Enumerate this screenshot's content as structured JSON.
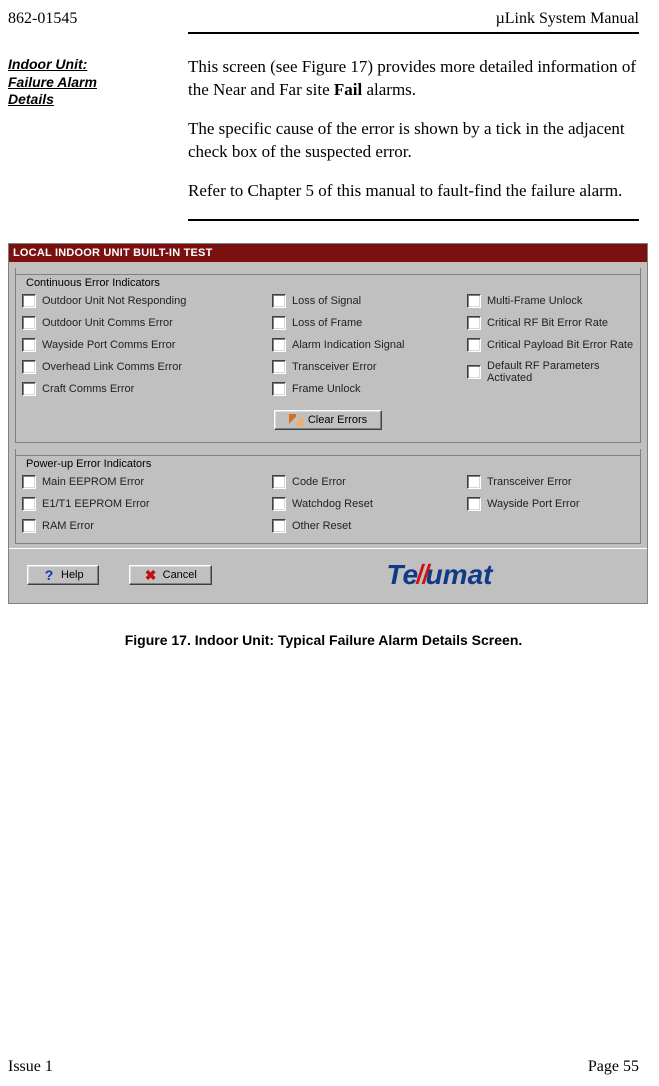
{
  "header": {
    "left": "862-01545",
    "right": "µLink System Manual"
  },
  "side": {
    "heading_line1": "Indoor Unit:",
    "heading_line2": "Failure Alarm",
    "heading_line3": "Details"
  },
  "body": {
    "p1_a": "This screen (see Figure 17) provides more detailed information of the Near and Far site ",
    "p1_bold": "Fail",
    "p1_b": " alarms.",
    "p2": "The specific cause of the error is shown by a tick in the adjacent check box of the suspected error.",
    "p3": "Refer to Chapter 5 of this manual to fault-find the failure alarm."
  },
  "window": {
    "title": "LOCAL INDOOR UNIT BUILT-IN TEST",
    "group1": {
      "legend": "Continuous Error Indicators",
      "col1": [
        "Outdoor Unit Not Responding",
        "Outdoor Unit Comms Error",
        "Wayside Port Comms Error",
        "Overhead Link Comms Error",
        "Craft Comms Error"
      ],
      "col2": [
        "Loss of Signal",
        "Loss of Frame",
        "Alarm Indication Signal",
        "Transceiver Error",
        "Frame Unlock"
      ],
      "col3": [
        "Multi-Frame Unlock",
        "Critical RF Bit Error Rate",
        "Critical Payload Bit Error Rate",
        "Default RF Parameters Activated"
      ],
      "clear_btn": "Clear Errors"
    },
    "group2": {
      "legend": "Power-up Error Indicators",
      "col1": [
        "Main EEPROM Error",
        "E1/T1 EEPROM Error",
        "RAM Error"
      ],
      "col2": [
        "Code Error",
        "Watchdog Reset",
        "Other Reset"
      ],
      "col3": [
        "Transceiver Error",
        "Wayside Port Error"
      ]
    },
    "help_btn": "Help",
    "cancel_btn": "Cancel",
    "logo_a": "Te",
    "logo_b": "ll",
    "logo_c": "umat"
  },
  "caption": "Figure 17.  Indoor Unit:  Typical Failure Alarm Details Screen.",
  "footer": {
    "left": "Issue 1",
    "right": "Page 55"
  }
}
